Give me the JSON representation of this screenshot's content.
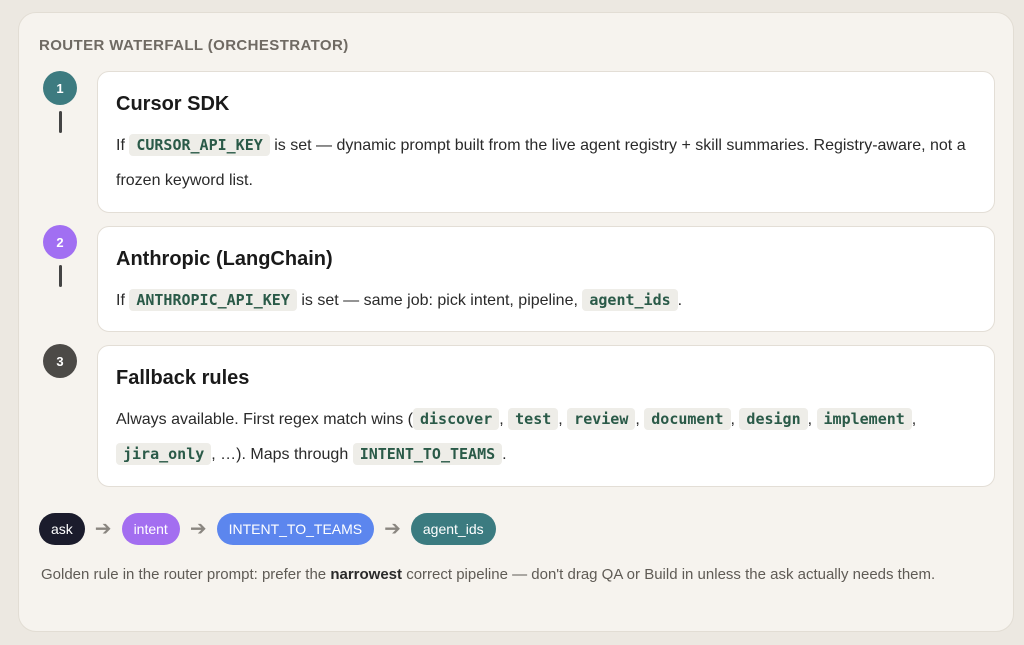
{
  "title": "ROUTER WATERFALL (ORCHESTRATOR)",
  "colors": {
    "step1": "#3d7b80",
    "step2": "#a16ff2",
    "step3": "#4c4a47",
    "pill_ask": "#1b1c2c",
    "pill_intent": "#a36ef0",
    "pill_teams": "#5c86ee",
    "pill_agents": "#3b7b80",
    "code_text": "#2a5a48"
  },
  "steps": [
    {
      "number": "1",
      "title": "Cursor SDK",
      "pre": "If",
      "code": "CURSOR_API_KEY",
      "post": "is set — dynamic prompt built from the live agent registry + skill summaries. Registry-aware, not a frozen keyword list."
    },
    {
      "number": "2",
      "title": "Anthropic (LangChain)",
      "pre": "If",
      "code": "ANTHROPIC_API_KEY",
      "mid": "is set — same job: pick intent, pipeline,",
      "code2": "agent_ids",
      "end": "."
    },
    {
      "number": "3",
      "title": "Fallback rules",
      "pre": "Always available. First regex match wins (",
      "codes": [
        "discover",
        "test",
        "review",
        "document",
        "design",
        "implement",
        "jira_only"
      ],
      "sep": ",",
      "ellipsis": ", …). Maps through",
      "code_last": "INTENT_TO_TEAMS",
      "end": "."
    }
  ],
  "flow": {
    "items": [
      "ask",
      "intent",
      "INTENT_TO_TEAMS",
      "agent_ids"
    ],
    "arrow": "➔"
  },
  "footnote": {
    "pre": "Golden rule in the router prompt: prefer the",
    "bold": "narrowest",
    "post": "correct pipeline — don't drag QA or Build in unless the ask actually needs them."
  }
}
